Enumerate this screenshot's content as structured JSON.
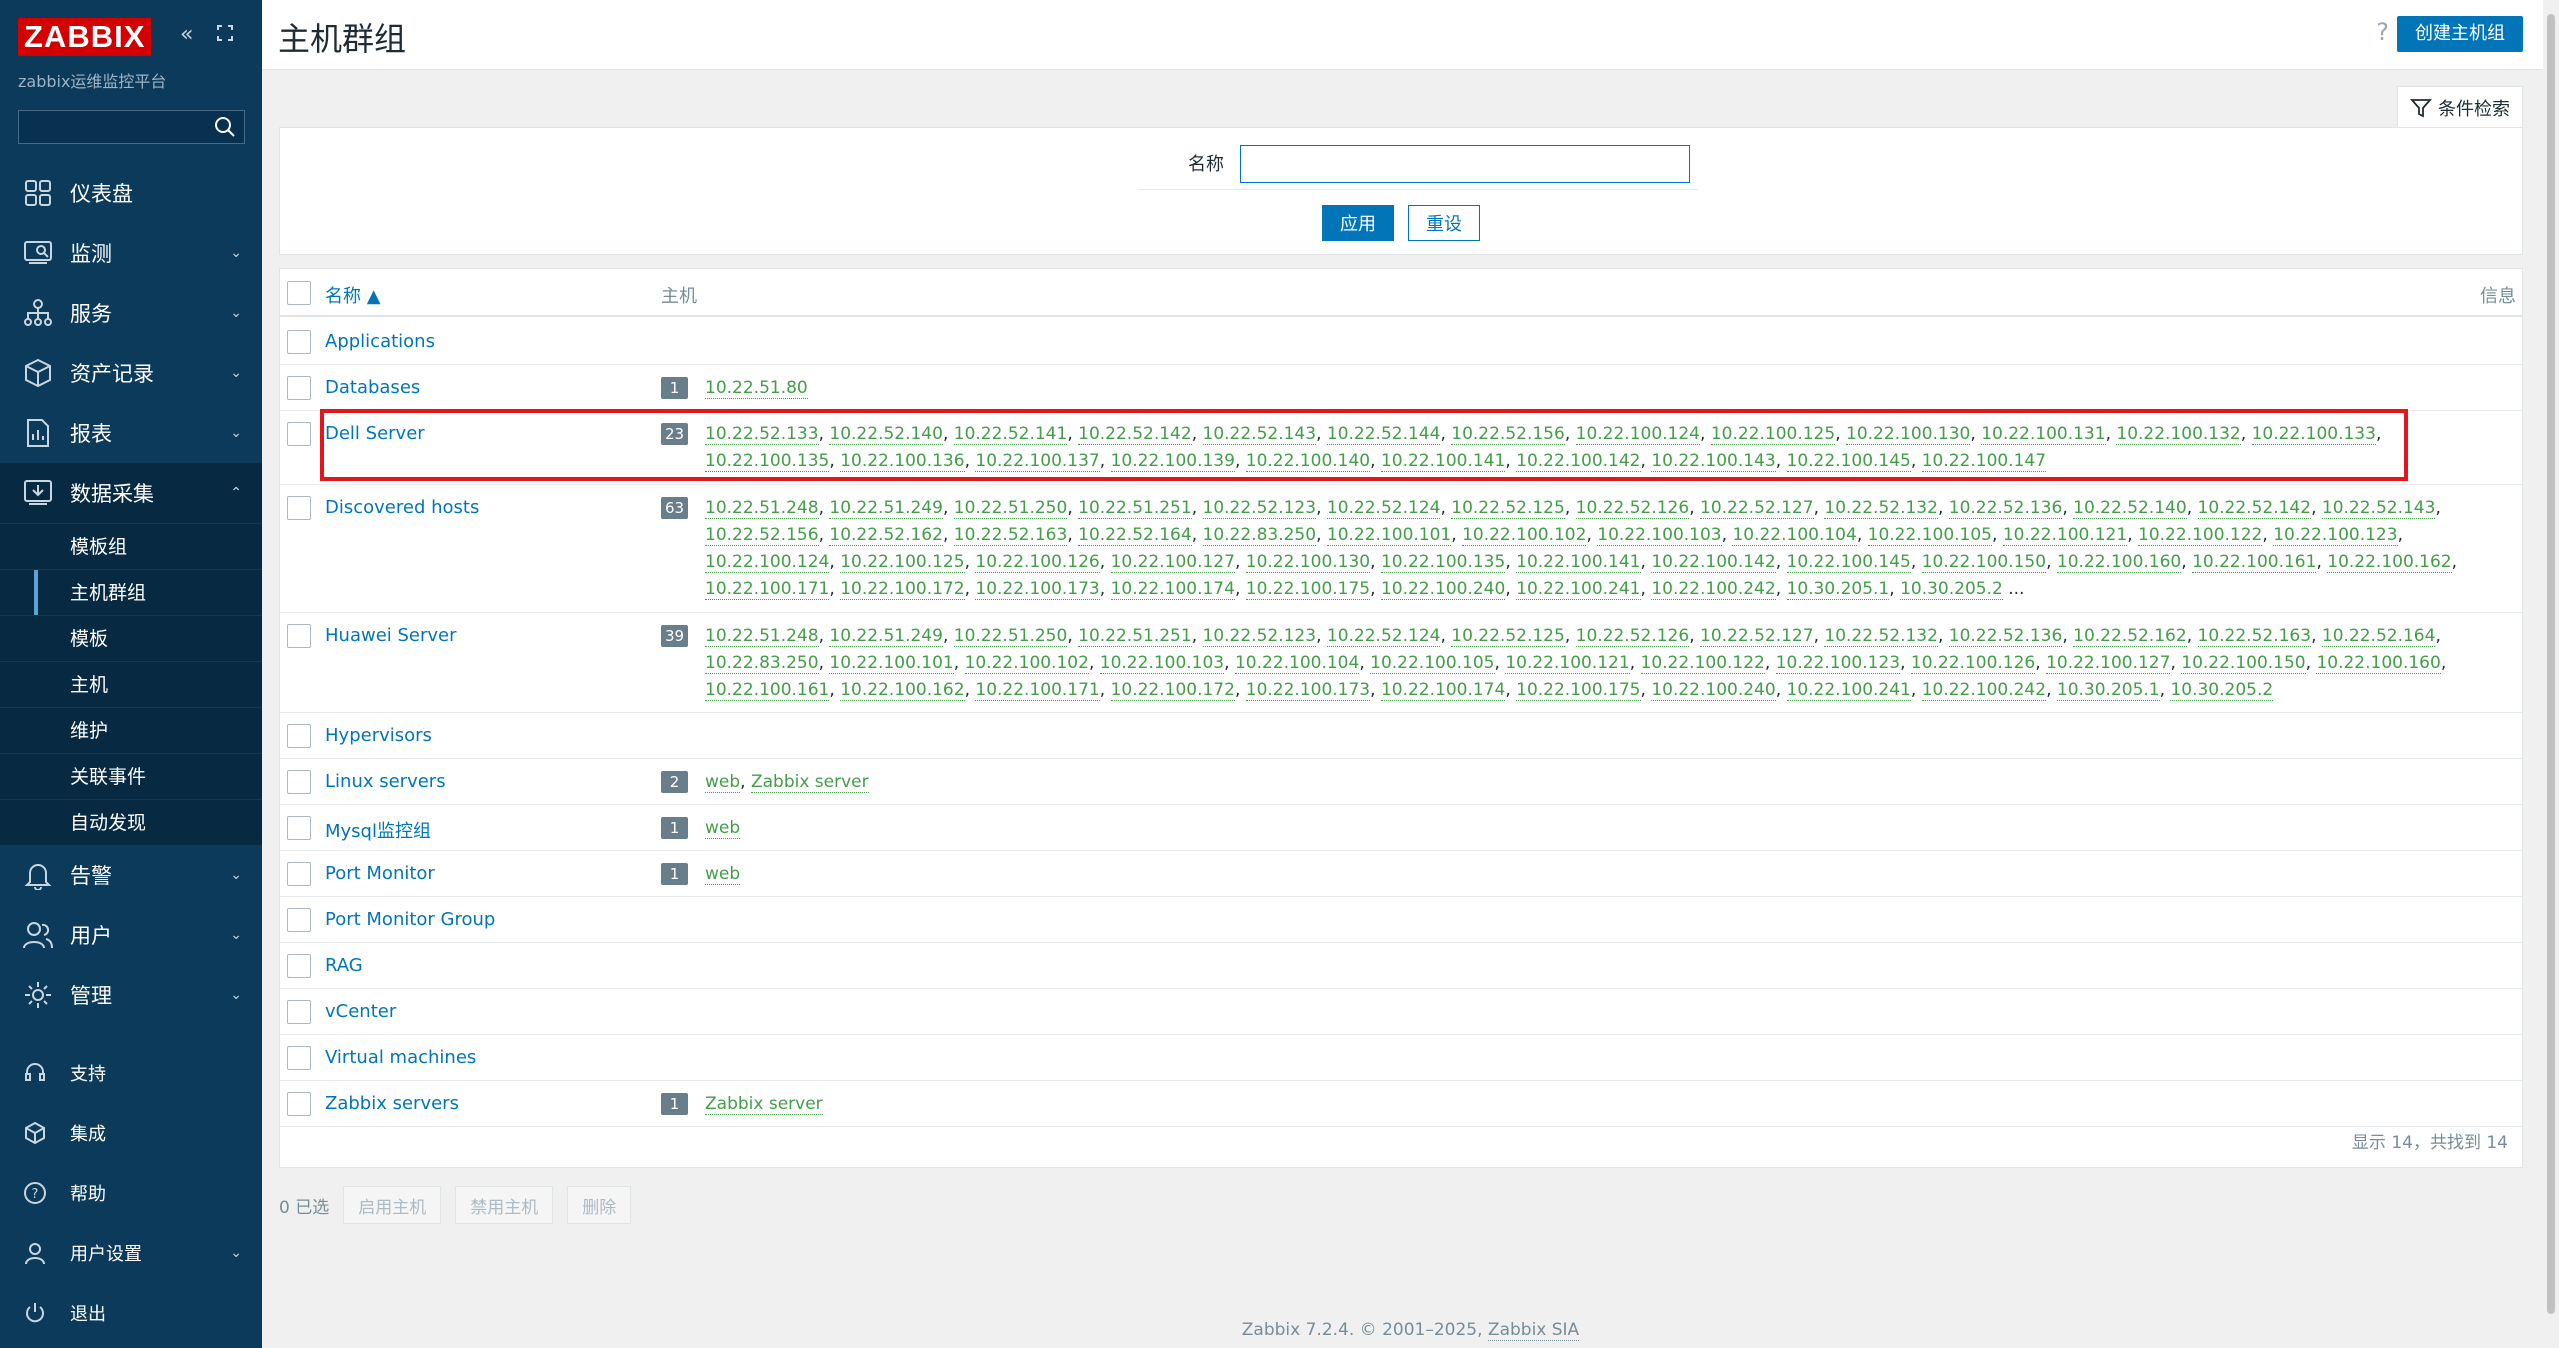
{
  "brand": {
    "logo": "ZABBIX",
    "subtitle": "zabbix运维监控平台"
  },
  "nav": {
    "items": [
      {
        "label": "仪表盘",
        "icon": "dashboard-icon"
      },
      {
        "label": "监测",
        "icon": "monitoring-icon"
      },
      {
        "label": "服务",
        "icon": "services-icon"
      },
      {
        "label": "资产记录",
        "icon": "inventory-icon"
      },
      {
        "label": "报表",
        "icon": "reports-icon"
      },
      {
        "label": "数据采集",
        "icon": "data-collection-icon"
      }
    ],
    "sub_items": [
      "模板组",
      "主机群组",
      "模板",
      "主机",
      "维护",
      "关联事件",
      "自动发现"
    ],
    "items_after": [
      {
        "label": "告警",
        "icon": "bell-icon"
      },
      {
        "label": "用户",
        "icon": "users-icon"
      },
      {
        "label": "管理",
        "icon": "gear-icon"
      }
    ],
    "bottom": [
      {
        "label": "支持",
        "icon": "support-icon"
      },
      {
        "label": "集成",
        "icon": "integrations-icon"
      },
      {
        "label": "帮助",
        "icon": "help-icon"
      },
      {
        "label": "用户设置",
        "icon": "user-settings-icon"
      },
      {
        "label": "退出",
        "icon": "power-icon"
      }
    ]
  },
  "header": {
    "title": "主机群组",
    "help": "?",
    "create_button": "创建主机组"
  },
  "filter": {
    "tab_label": "条件检索",
    "name_label": "名称",
    "name_value": "",
    "apply": "应用",
    "reset": "重设"
  },
  "table": {
    "headers": {
      "name": "名称 ▲",
      "hosts": "主机",
      "info": "信息"
    },
    "rows": [
      {
        "name": "Applications",
        "count": "",
        "hosts": []
      },
      {
        "name": "Databases",
        "count": "1",
        "hosts": [
          "10.22.51.80"
        ]
      },
      {
        "name": "Dell Server",
        "count": "23",
        "hosts": [
          "10.22.52.133",
          "10.22.52.140",
          "10.22.52.141",
          "10.22.52.142",
          "10.22.52.143",
          "10.22.52.144",
          "10.22.52.156",
          "10.22.100.124",
          "10.22.100.125",
          "10.22.100.130",
          "10.22.100.131",
          "10.22.100.132",
          "10.22.100.133",
          "10.22.100.135",
          "10.22.100.136",
          "10.22.100.137",
          "10.22.100.139",
          "10.22.100.140",
          "10.22.100.141",
          "10.22.100.142",
          "10.22.100.143",
          "10.22.100.145",
          "10.22.100.147"
        ]
      },
      {
        "name": "Discovered hosts",
        "count": "63",
        "hosts": [
          "10.22.51.248",
          "10.22.51.249",
          "10.22.51.250",
          "10.22.51.251",
          "10.22.52.123",
          "10.22.52.124",
          "10.22.52.125",
          "10.22.52.126",
          "10.22.52.127",
          "10.22.52.132",
          "10.22.52.136",
          "10.22.52.140",
          "10.22.52.142",
          "10.22.52.143",
          "10.22.52.156",
          "10.22.52.162",
          "10.22.52.163",
          "10.22.52.164",
          "10.22.83.250",
          "10.22.100.101",
          "10.22.100.102",
          "10.22.100.103",
          "10.22.100.104",
          "10.22.100.105",
          "10.22.100.121",
          "10.22.100.122",
          "10.22.100.123",
          "10.22.100.124",
          "10.22.100.125",
          "10.22.100.126",
          "10.22.100.127",
          "10.22.100.130",
          "10.22.100.135",
          "10.22.100.141",
          "10.22.100.142",
          "10.22.100.145",
          "10.22.100.150",
          "10.22.100.160",
          "10.22.100.161",
          "10.22.100.162",
          "10.22.100.171",
          "10.22.100.172",
          "10.22.100.173",
          "10.22.100.174",
          "10.22.100.175",
          "10.22.100.240",
          "10.22.100.241",
          "10.22.100.242",
          "10.30.205.1",
          "10.30.205.2"
        ],
        "more": " ..."
      },
      {
        "name": "Huawei Server",
        "count": "39",
        "hosts": [
          "10.22.51.248",
          "10.22.51.249",
          "10.22.51.250",
          "10.22.51.251",
          "10.22.52.123",
          "10.22.52.124",
          "10.22.52.125",
          "10.22.52.126",
          "10.22.52.127",
          "10.22.52.132",
          "10.22.52.136",
          "10.22.52.162",
          "10.22.52.163",
          "10.22.52.164",
          "10.22.83.250",
          "10.22.100.101",
          "10.22.100.102",
          "10.22.100.103",
          "10.22.100.104",
          "10.22.100.105",
          "10.22.100.121",
          "10.22.100.122",
          "10.22.100.123",
          "10.22.100.126",
          "10.22.100.127",
          "10.22.100.150",
          "10.22.100.160",
          "10.22.100.161",
          "10.22.100.162",
          "10.22.100.171",
          "10.22.100.172",
          "10.22.100.173",
          "10.22.100.174",
          "10.22.100.175",
          "10.22.100.240",
          "10.22.100.241",
          "10.22.100.242",
          "10.30.205.1",
          "10.30.205.2"
        ]
      },
      {
        "name": "Hypervisors",
        "count": "",
        "hosts": []
      },
      {
        "name": "Linux servers",
        "count": "2",
        "hosts": [
          "web",
          "Zabbix server"
        ]
      },
      {
        "name": "Mysql监控组",
        "count": "1",
        "hosts": [
          "web"
        ]
      },
      {
        "name": "Port Monitor",
        "count": "1",
        "hosts": [
          "web"
        ]
      },
      {
        "name": "Port Monitor Group",
        "count": "",
        "hosts": []
      },
      {
        "name": "RAG",
        "count": "",
        "hosts": []
      },
      {
        "name": "vCenter",
        "count": "",
        "hosts": []
      },
      {
        "name": "Virtual machines",
        "count": "",
        "hosts": []
      },
      {
        "name": "Zabbix servers",
        "count": "1",
        "hosts": [
          "Zabbix server"
        ]
      }
    ],
    "summary": "显示 14，共找到 14"
  },
  "actions": {
    "selected": "0 已选",
    "enable": "启用主机",
    "disable": "禁用主机",
    "delete": "删除"
  },
  "footer": {
    "text": "Zabbix 7.2.4. © 2001–2025, ",
    "company": "Zabbix SIA"
  },
  "colors": {
    "sidebar": "#0b3a5a",
    "accent": "#0275b8",
    "host_link": "#429e47",
    "highlight": "#e3161c"
  }
}
